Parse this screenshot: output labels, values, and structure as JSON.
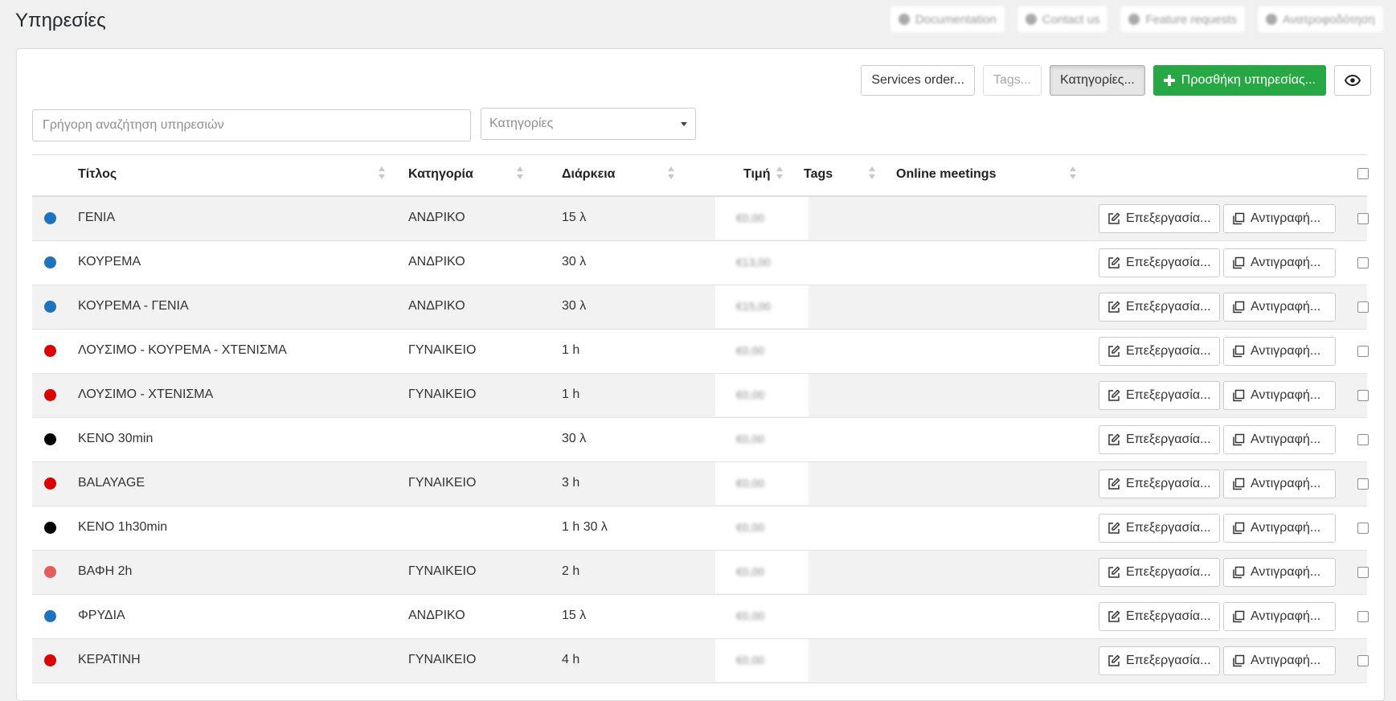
{
  "page": {
    "title": "Υπηρεσίες"
  },
  "top_links": [
    {
      "label": "Documentation",
      "icon": "info-icon"
    },
    {
      "label": "Contact us",
      "icon": "chat-icon"
    },
    {
      "label": "Feature requests",
      "icon": "lightbulb-icon"
    },
    {
      "label": "Ανατροφοδότηση",
      "icon": "feedback-icon"
    }
  ],
  "toolbar": {
    "services_order": "Services order...",
    "tags": "Tags...",
    "categories": "Κατηγορίες...",
    "add_service": "Προσθήκη υπηρεσίας...",
    "visibility_icon": "eye-icon"
  },
  "filters": {
    "search_placeholder": "Γρήγορη αναζήτηση υπηρεσιών",
    "category_placeholder": "Κατηγορίες"
  },
  "table": {
    "columns": {
      "title": "Τίτλος",
      "category": "Κατηγορία",
      "duration": "Διάρκεια",
      "price": "Τιμή",
      "tags": "Tags",
      "online_meetings": "Online meetings"
    },
    "row_actions": {
      "edit": "Επεξεργασία...",
      "copy": "Αντιγραφή..."
    },
    "rows": [
      {
        "color": "#1e73be",
        "title": "ΓΕΝΙΑ",
        "category": "ΑΝΔΡΙΚΟ",
        "duration": "15 λ",
        "price": "€0,00"
      },
      {
        "color": "#1e73be",
        "title": "ΚΟΥΡΕΜΑ",
        "category": "ΑΝΔΡΙΚΟ",
        "duration": "30 λ",
        "price": "€13,00"
      },
      {
        "color": "#1e73be",
        "title": "ΚΟΥΡΕΜΑ - ΓΕΝΙΑ",
        "category": "ΑΝΔΡΙΚΟ",
        "duration": "30 λ",
        "price": "€15,00"
      },
      {
        "color": "#dd0000",
        "title": "ΛΟΥΣΙΜΟ - ΚΟΥΡΕΜΑ - ΧΤΕΝΙΣΜΑ",
        "category": "ΓΥΝΑΙΚΕΙΟ",
        "duration": "1 h",
        "price": "€0,00"
      },
      {
        "color": "#dd0000",
        "title": "ΛΟΥΣΙΜΟ - ΧΤΕΝΙΣΜΑ",
        "category": "ΓΥΝΑΙΚΕΙΟ",
        "duration": "1 h",
        "price": "€0,00"
      },
      {
        "color": "#000000",
        "title": "ΚΕΝΟ 30min",
        "category": "",
        "duration": "30 λ",
        "price": "€0,00"
      },
      {
        "color": "#dd0000",
        "title": "BALAYAGE",
        "category": "ΓΥΝΑΙΚΕΙΟ",
        "duration": "3 h",
        "price": "€0,00"
      },
      {
        "color": "#000000",
        "title": "ΚΕΝΟ 1h30min",
        "category": "",
        "duration": "1 h 30 λ",
        "price": "€0,00"
      },
      {
        "color": "#e45c5c",
        "title": "ΒΑΦΗ 2h",
        "category": "ΓΥΝΑΙΚΕΙΟ",
        "duration": "2 h",
        "price": "€0,00"
      },
      {
        "color": "#1e73be",
        "title": "ΦΡΥΔΙΑ",
        "category": "ΑΝΔΡΙΚΟ",
        "duration": "15 λ",
        "price": "€0,00"
      },
      {
        "color": "#dd0000",
        "title": "ΚΕΡΑΤΙΝΗ",
        "category": "ΓΥΝΑΙΚΕΙΟ",
        "duration": "4 h",
        "price": "€0,00"
      }
    ]
  }
}
